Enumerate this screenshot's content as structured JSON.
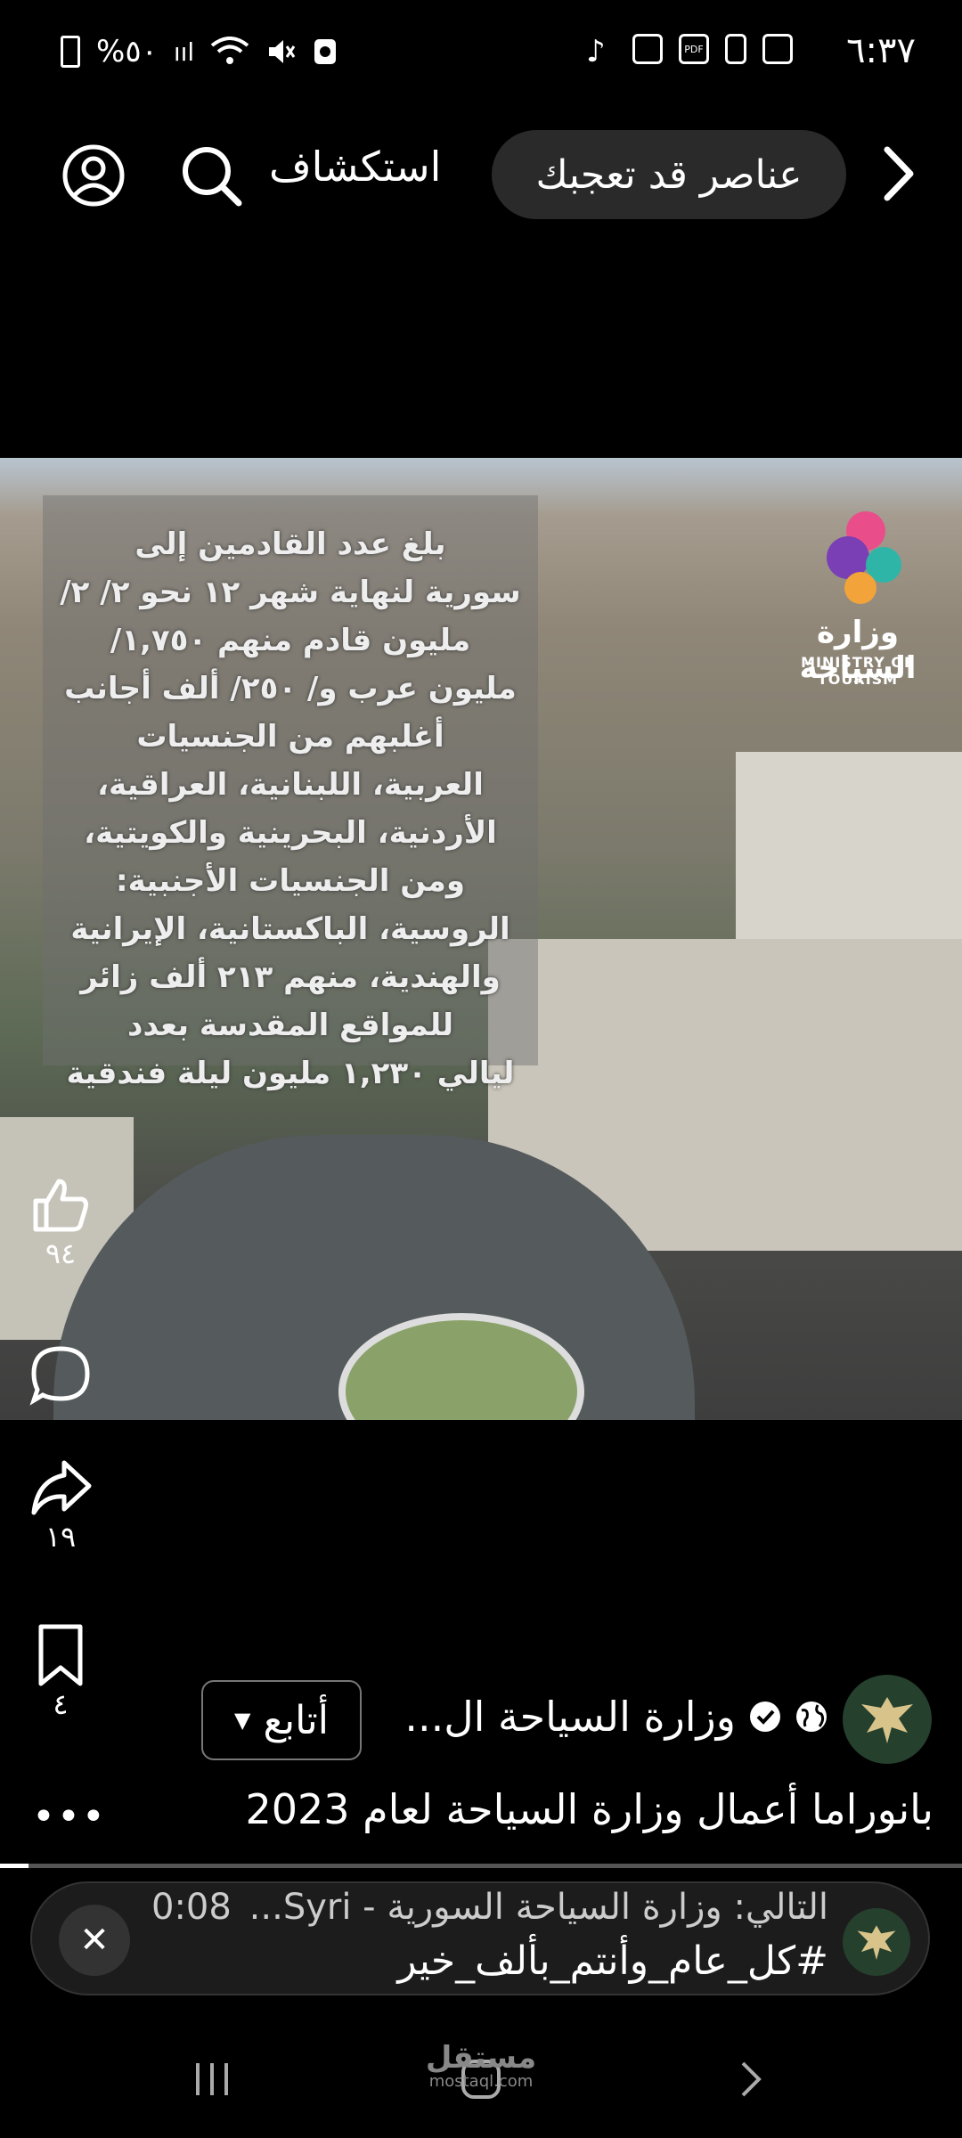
{
  "status_bar": {
    "time": "٦:٣٧",
    "battery": "%٥٠",
    "icons": [
      "gallery-icon",
      "phone-icon",
      "pdf-icon",
      "app-icon",
      "tiktok-icon",
      "signal-icon",
      "wifi-icon",
      "mute-icon",
      "recycle-icon"
    ]
  },
  "header": {
    "chip_label": "عناصر قد تعجبك",
    "explore_label": "استكشاف"
  },
  "video": {
    "overlay_lines": [
      "بلغ عدد القادمين إلى",
      "سورية لنهاية شهر ١٢ نحو ٢/ ٢/",
      "مليون قادم منهم ١,٧٥٠/",
      "مليون عرب و/ ٢٥٠/ ألف أجانب",
      "أغلبهم من الجنسيات",
      "العربية، اللبنانية، العراقية،",
      "الأردنية، البحرينية والكويتية،",
      "ومن الجنسيات الأجنبية:",
      "الروسية، الباكستانية، الإيرانية",
      "والهندية، منهم ٢١٣ ألف زائر",
      "للمواقع المقدسة بعدد",
      "ليالي ١,٢٣٠ مليون ليلة فندقية"
    ],
    "logo_ar": "وزارة السياحة",
    "logo_en": "MINISTRY OF TOURISM"
  },
  "actions": {
    "likes": "٩٤",
    "shares": "١٩",
    "saves": "٤"
  },
  "channel": {
    "name": "وزارة السياحة ال...",
    "follow_label": "أتابع"
  },
  "post": {
    "title": "بانوراما أعمال وزارة السياحة لعام 2023",
    "progress_fraction": 0.03
  },
  "next_up": {
    "label": "التالي: وزارة السياحة السورية - Syri...",
    "duration": "0:08",
    "hashtag": "#كل_عام_وأنتم_بألف_خير"
  },
  "watermark": {
    "ar": "مستقل",
    "en": "mostaql.com"
  }
}
